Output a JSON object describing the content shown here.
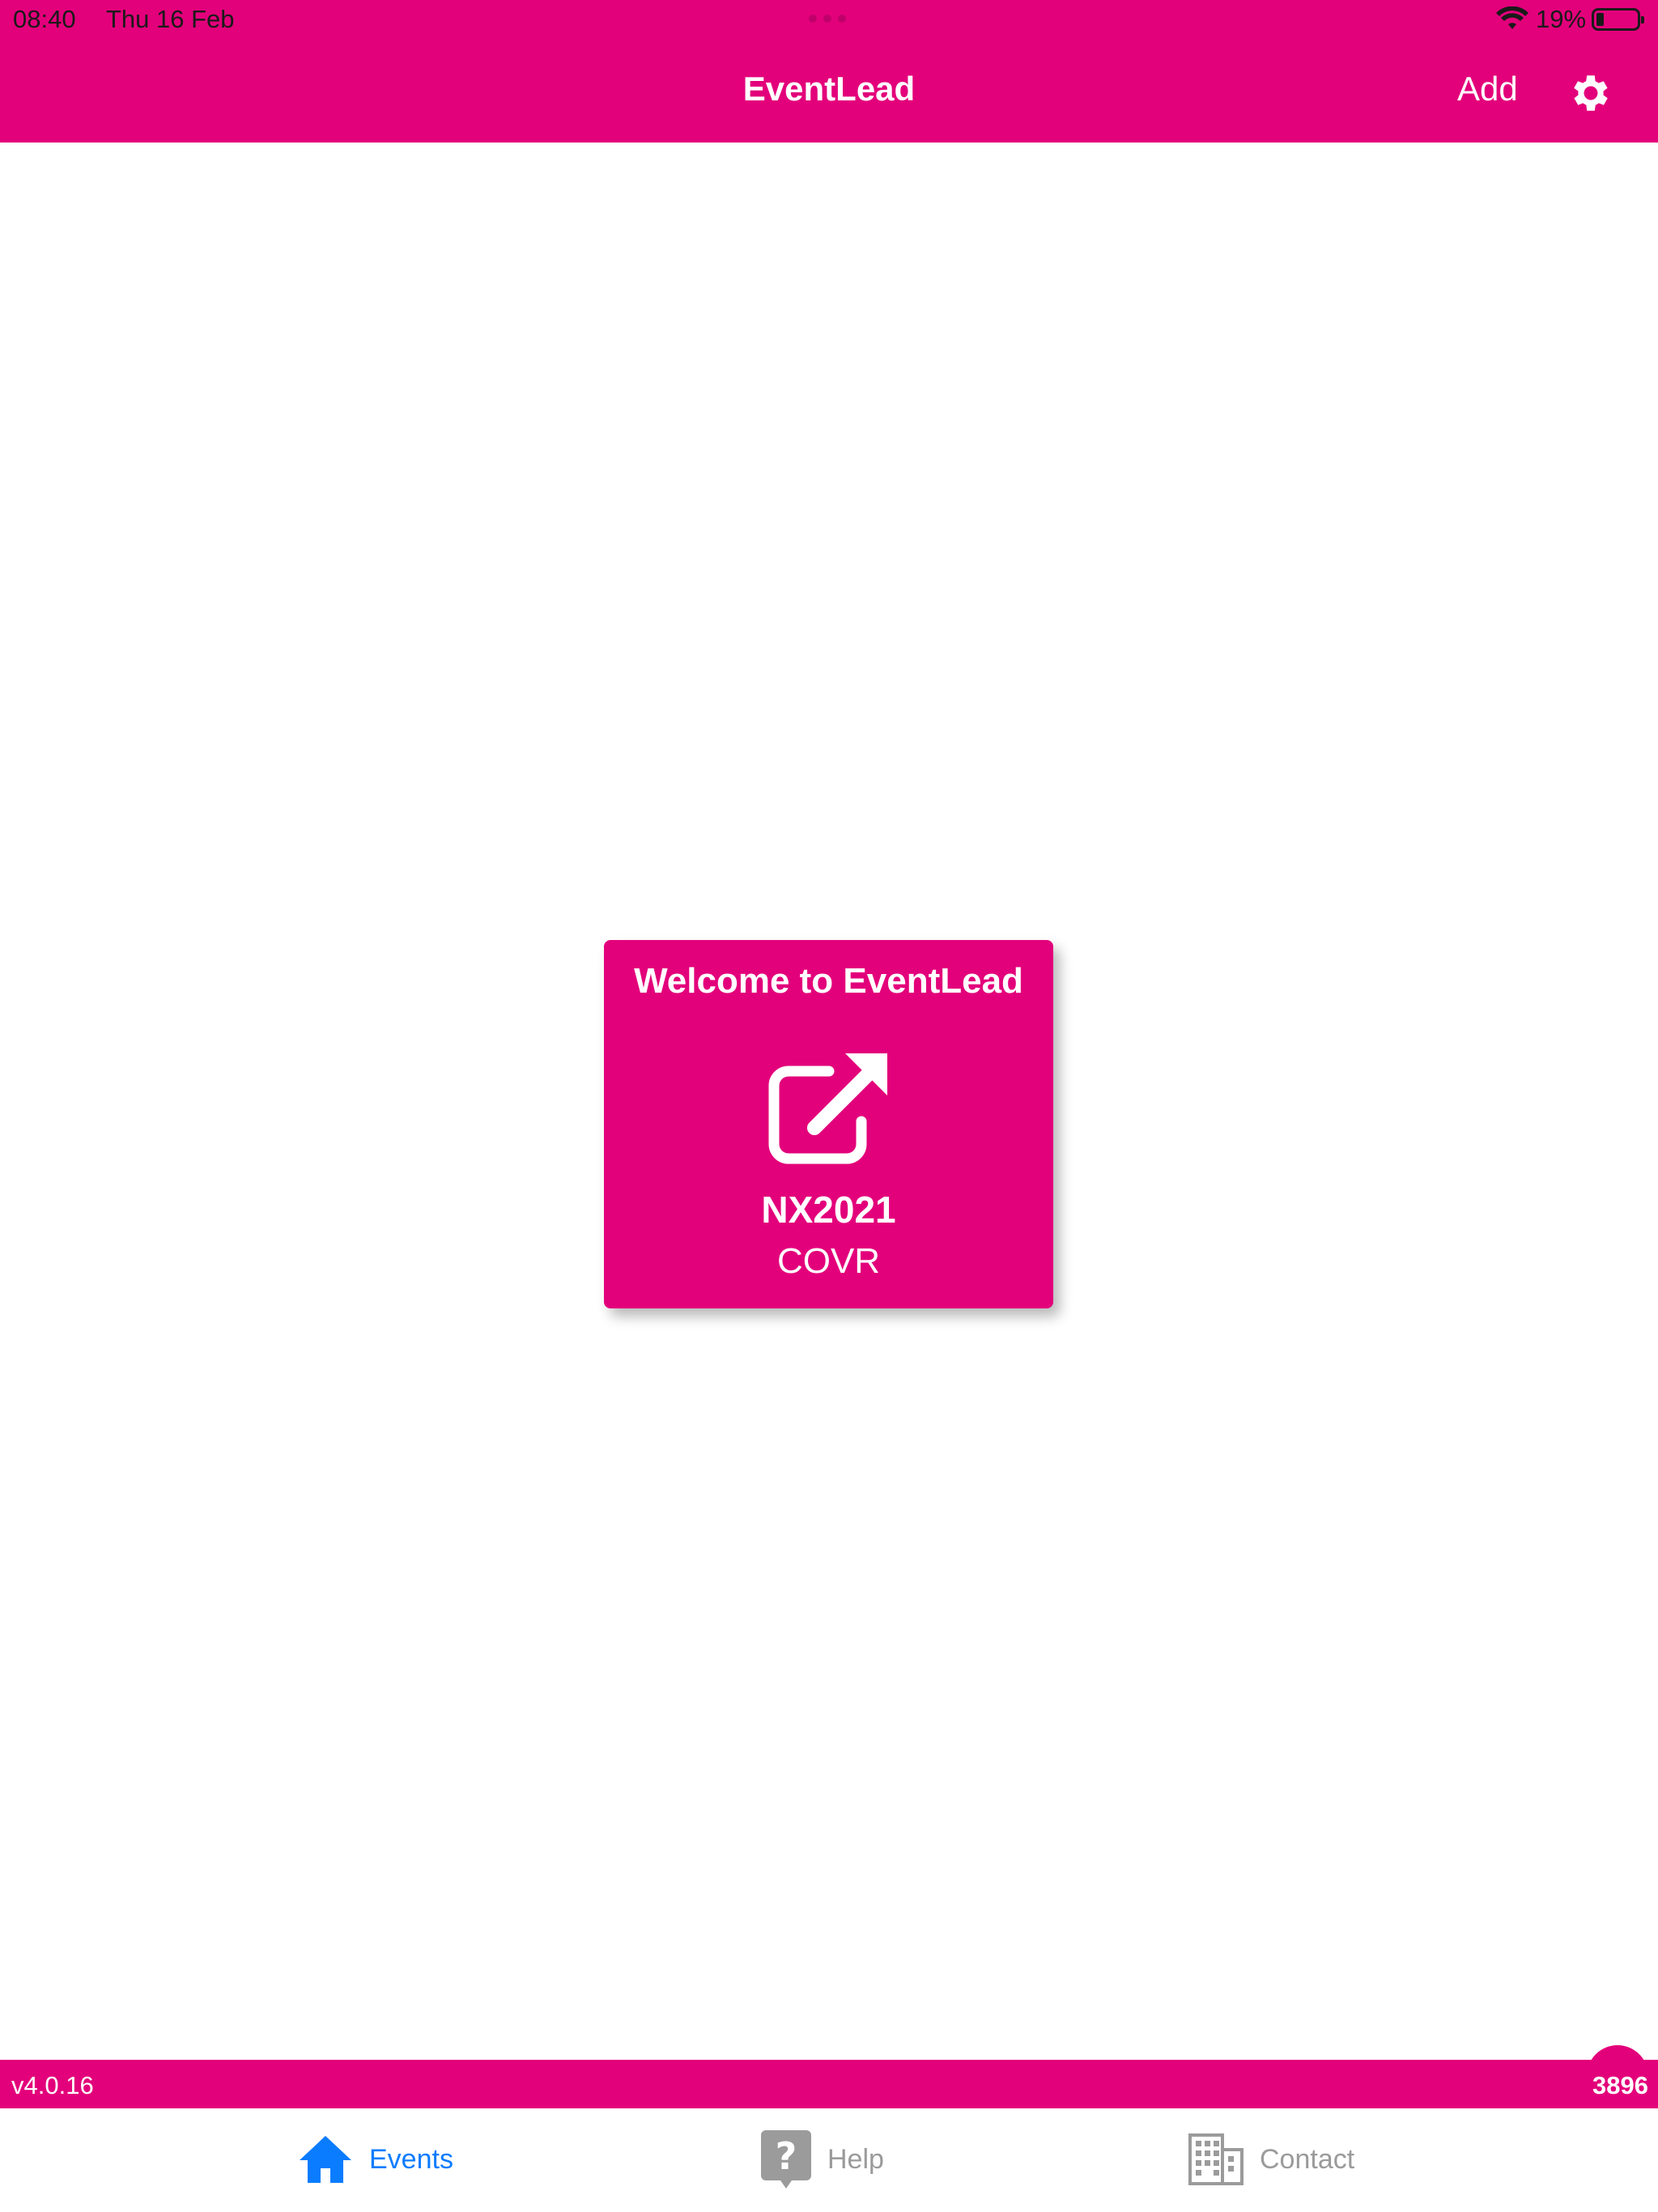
{
  "status_bar": {
    "time": "08:40",
    "date": "Thu 16 Feb",
    "battery_percent": "19%",
    "battery_level": 0.19
  },
  "header": {
    "title": "EventLead",
    "add_label": "Add",
    "settings_icon": "gear-icon"
  },
  "card": {
    "title": "Welcome to EventLead",
    "icon": "external-link-icon",
    "code": "NX2021",
    "subtitle": "COVR"
  },
  "footer": {
    "version": "v4.0.16",
    "count": "3896"
  },
  "tabs": [
    {
      "label": "Events",
      "icon": "home-icon",
      "active": true
    },
    {
      "label": "Help",
      "icon": "help-icon",
      "active": false
    },
    {
      "label": "Contact",
      "icon": "building-icon",
      "active": false
    }
  ],
  "colors": {
    "brand": "#e3007b",
    "active_tab": "#0a7cff",
    "inactive_tab": "#9b9b9b"
  }
}
